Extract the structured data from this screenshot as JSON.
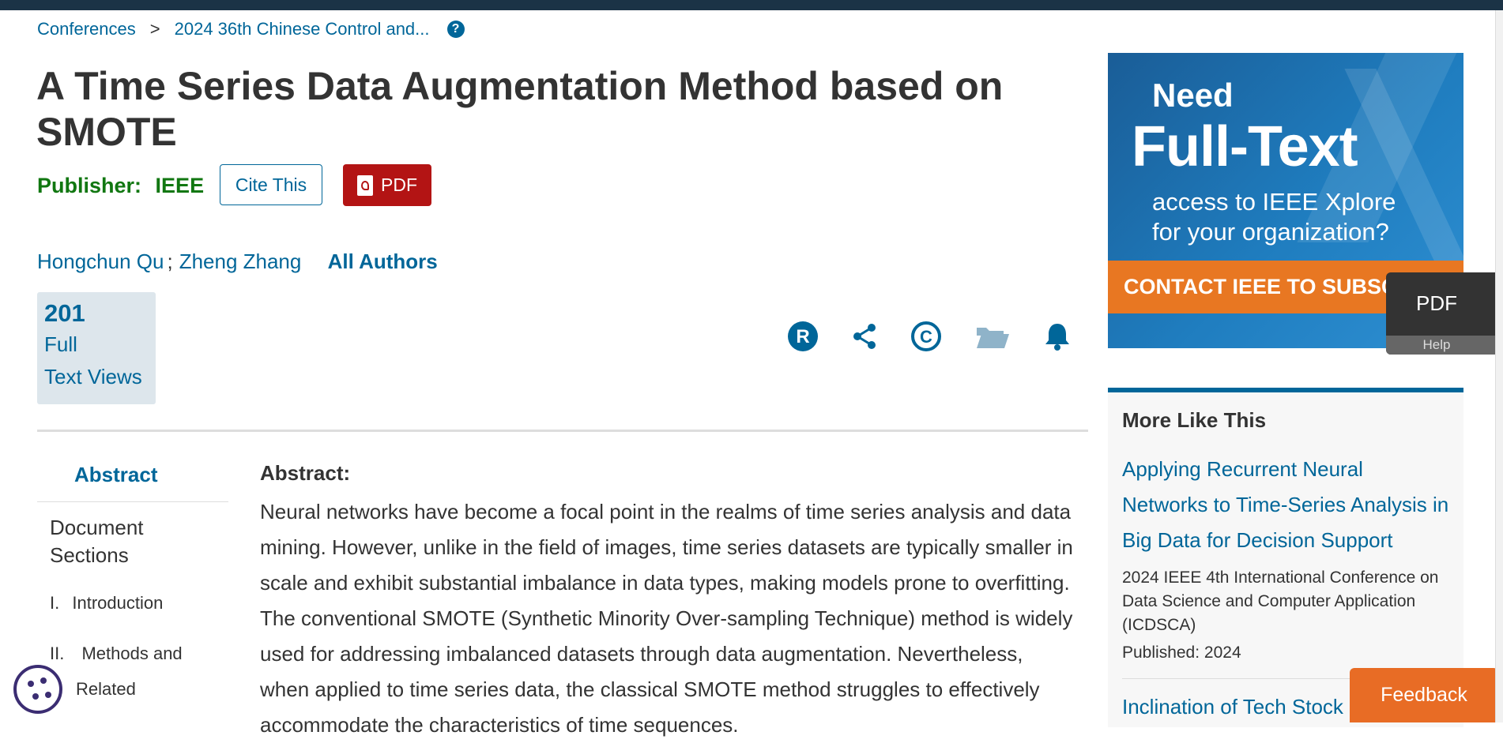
{
  "breadcrumb": {
    "items": [
      "Conferences",
      "2024 36th Chinese Control and..."
    ],
    "separator": ">",
    "help_icon": "question-circle-icon"
  },
  "article": {
    "title": "A Time Series Data Augmentation Method based on SMOTE",
    "publisher_label": "Publisher:",
    "publisher_name": "IEEE",
    "cite_label": "Cite This",
    "pdf_label": "PDF",
    "authors": [
      "Hongchun Qu",
      "Zheng Zhang"
    ],
    "author_sep": ";",
    "all_authors_label": "All Authors"
  },
  "metrics": {
    "views_count": "201",
    "views_label_line1": "Full",
    "views_label_line2": "Text Views"
  },
  "actions": {
    "icons": [
      "rights-r-icon",
      "share-icon",
      "copyright-icon",
      "folder-icon",
      "bell-alert-icon"
    ],
    "colors": {
      "primary": "#006699",
      "muted": "#8fb3c9"
    }
  },
  "toc": {
    "abstract": "Abstract",
    "doc_sections_line1": "Document",
    "doc_sections_line2": "Sections",
    "items": [
      {
        "num": "I.",
        "label": "Introduction"
      },
      {
        "num": "II.",
        "label": "Methods and"
      },
      {
        "num": "",
        "label": "Related"
      }
    ]
  },
  "abstract": {
    "heading": "Abstract:",
    "text": "Neural networks have become a focal point in the realms of time series analysis and data mining. However, unlike in the field of images, time series datasets are typically smaller in scale and exhibit substantial imbalance in data types, making models prone to overfitting. The conventional SMOTE (Synthetic Minority Over-sampling Technique) method is widely used for addressing imbalanced datasets through data augmentation. Nevertheless, when applied to time series data, the classical SMOTE method struggles to effectively accommodate the characteristics of time sequences."
  },
  "ad": {
    "line1": "Need",
    "line2": "Full-Text",
    "line3": "access to IEEE Xplore",
    "line4": "for your organization?",
    "cta": "CONTACT IEEE TO SUBSCRIBE"
  },
  "floating_pdf": {
    "label": "PDF",
    "help": "Help"
  },
  "more_like_this": {
    "title": "More Like This",
    "items": [
      {
        "title": "Applying Recurrent Neural Networks to Time-Series Analysis in Big Data for Decision Support",
        "conference": "2024 IEEE 4th International Conference on Data Science and Computer Application (ICDSCA)",
        "published": "Published: 2024"
      },
      {
        "title": "Inclination of Tech Stock"
      }
    ]
  },
  "feedback_label": "Feedback",
  "colors": {
    "link": "#006699",
    "publisher": "#117711",
    "pdf_button": "#b31414",
    "topbar": "#1b3346",
    "feedback": "#e86c25",
    "ad_cta": "#e87722"
  }
}
